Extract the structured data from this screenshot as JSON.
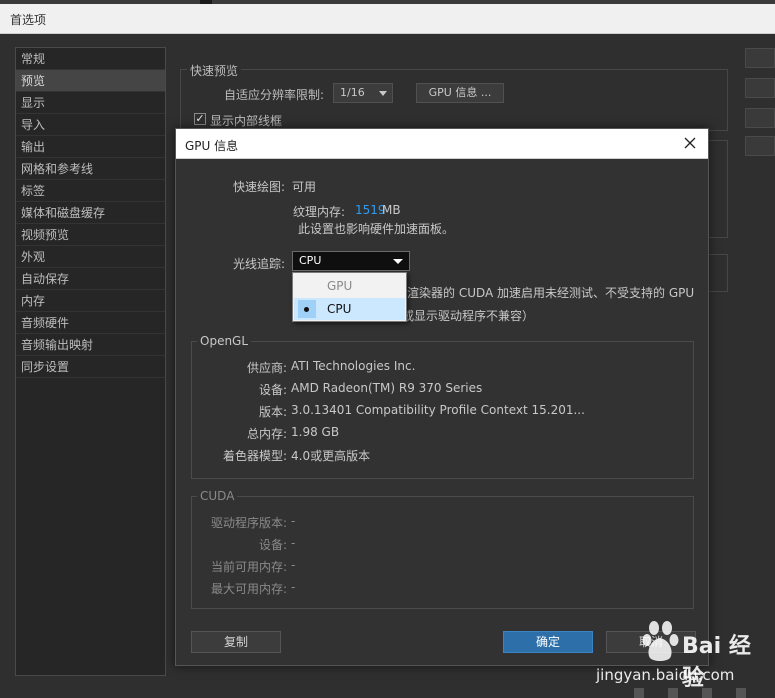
{
  "window": {
    "title": "首选项"
  },
  "sidebar": {
    "items": [
      {
        "label": "常规"
      },
      {
        "label": "预览",
        "selected": true
      },
      {
        "label": "显示"
      },
      {
        "label": "导入"
      },
      {
        "label": "输出"
      },
      {
        "label": "网格和参考线"
      },
      {
        "label": "标签"
      },
      {
        "label": "媒体和磁盘缓存"
      },
      {
        "label": "视频预览"
      },
      {
        "label": "外观"
      },
      {
        "label": "自动保存"
      },
      {
        "label": "内存"
      },
      {
        "label": "音频硬件"
      },
      {
        "label": "音频输出映射"
      },
      {
        "label": "同步设置"
      }
    ]
  },
  "preview_panel": {
    "section_title": "快速预览",
    "resolution_label": "自适应分辨率限制:",
    "resolution_value": "1/16",
    "gpu_info_button": "GPU 信息 ...",
    "show_wireframe_label": "显示内部线框",
    "show_wireframe_checked": true
  },
  "gpu_dialog": {
    "title": "GPU 信息",
    "fast_draw_label": "快速绘图:",
    "fast_draw_value": "可用",
    "texture_memory_label": "纹理内存:",
    "texture_memory_value": "1519",
    "texture_memory_unit": "MB",
    "note": "此设置也影响硬件加速面板。",
    "ray_tracer_label": "光线追踪:",
    "ray_tracer_value": "CPU",
    "ray_tracer_options": [
      "GPU",
      "CPU"
    ],
    "ray_tracer_selected_index": 1,
    "cuda_warning_line1": "渲染器的 CUDA 加速启用未经测试、不受支持的 GPU",
    "cuda_warning_line2": "或显示驱动程序不兼容）",
    "opengl": {
      "title": "OpenGL",
      "rows": [
        {
          "label": "供应商:",
          "value": "ATI Technologies Inc."
        },
        {
          "label": "设备:",
          "value": "AMD Radeon(TM) R9 370 Series"
        },
        {
          "label": "版本:",
          "value": "3.0.13401 Compatibility Profile Context 15.201..."
        },
        {
          "label": "总内存:",
          "value": "1.98 GB"
        },
        {
          "label": "着色器模型:",
          "value": "4.0或更高版本"
        }
      ]
    },
    "cuda": {
      "title": "CUDA",
      "rows": [
        {
          "label": "驱动程序版本:",
          "value": "-"
        },
        {
          "label": "设备:",
          "value": "-"
        },
        {
          "label": "当前可用内存:",
          "value": "-"
        },
        {
          "label": "最大可用内存:",
          "value": "-"
        }
      ]
    },
    "copy_button": "复制",
    "ok_button": "确定",
    "cancel_button": "取消"
  },
  "watermark": {
    "brand": "Bai 经验",
    "url": "jingyan.baidu.com"
  },
  "colors": {
    "accent": "#2d9bf0",
    "ok_button": "#2d6fa8",
    "dropdown_highlight": "#cce8ff"
  }
}
